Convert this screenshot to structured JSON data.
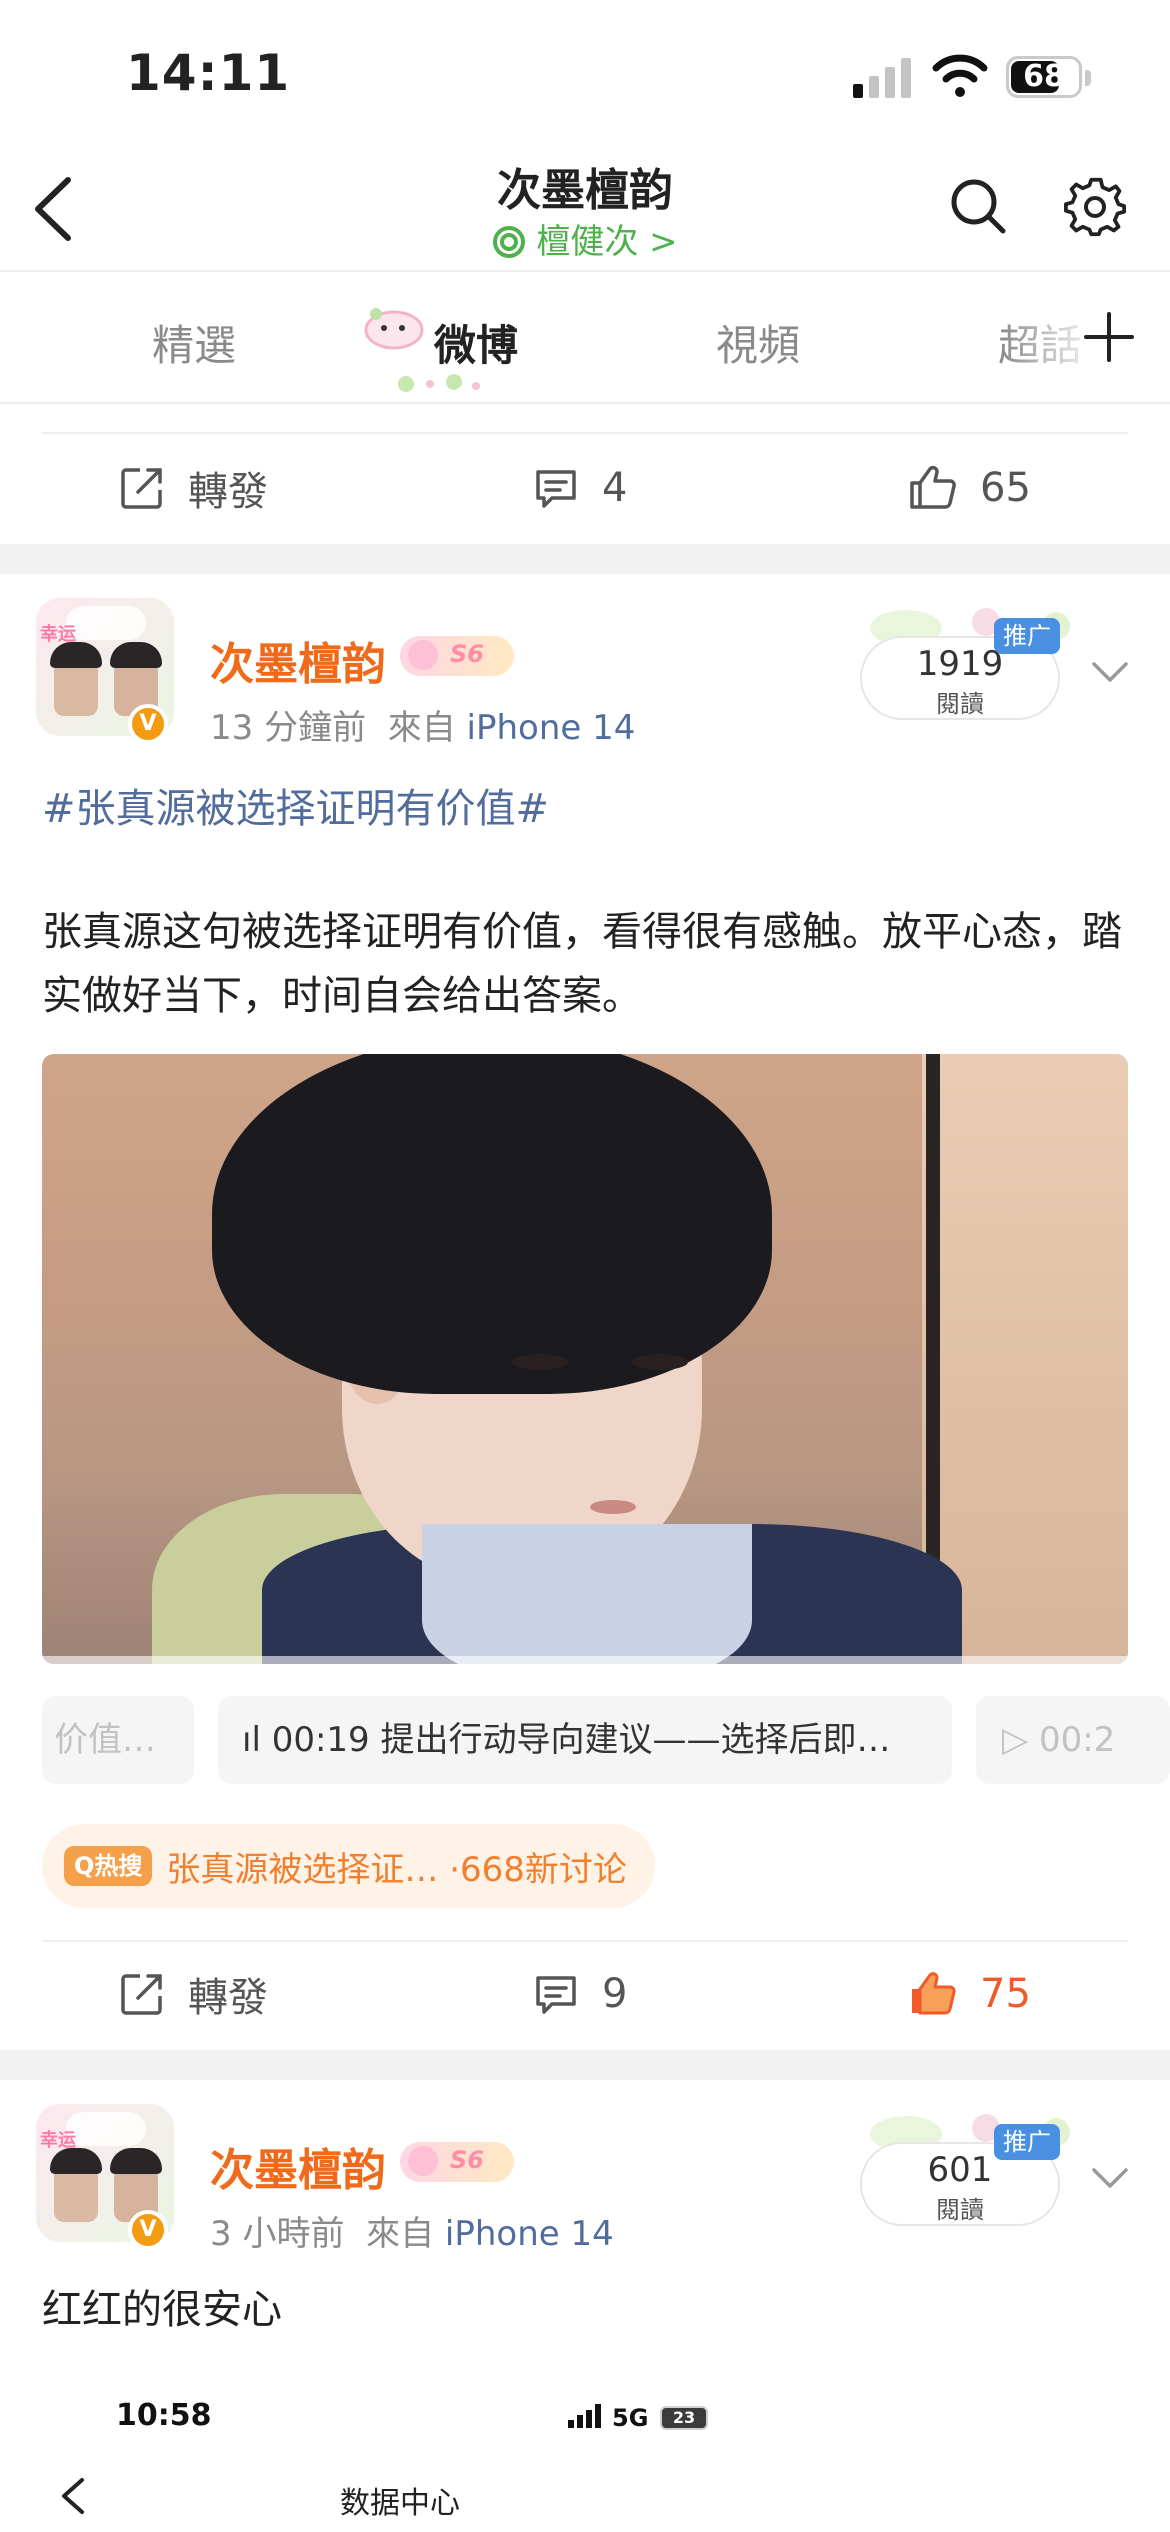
{
  "status": {
    "time": "14:11",
    "battery": "68"
  },
  "nav": {
    "title": "次墨檀韵",
    "subtitle": "檀健次 >"
  },
  "tabs": [
    {
      "label": "精選"
    },
    {
      "label": "微博"
    },
    {
      "label": "視頻"
    },
    {
      "label": "超話"
    }
  ],
  "prev_post": {
    "repost_label": "轉發",
    "comments": "4",
    "likes": "65"
  },
  "posts": [
    {
      "author": "次墨檀韵",
      "level": "S6",
      "time": "13 分鐘前",
      "from": "來自",
      "device": "iPhone 14",
      "reads": "1919",
      "reads_label": "閱讀",
      "promo": "推广",
      "hashtag": "#张真源被选择证明有价值#",
      "text": "张真源这句被选择证明有价值，看得很有感触。放平心态，踏实做好当下，时间自会给出答案。",
      "chapters": [
        {
          "label": "价值…"
        },
        {
          "label": "ıl 00:19 提出行动导向建议——选择后即…"
        },
        {
          "label": "▷ 00:2"
        }
      ],
      "hot": {
        "badge": "Q热搜",
        "text": "张真源被选择证… ·668新讨论"
      },
      "repost_label": "轉發",
      "comments": "9",
      "likes": "75"
    },
    {
      "author": "次墨檀韵",
      "level": "S6",
      "time": "3 小時前",
      "from": "來自",
      "device": "iPhone 14",
      "reads": "601",
      "reads_label": "閱讀",
      "promo": "推广",
      "text": "红红的很安心"
    }
  ],
  "embedded_screenshot": {
    "time": "10:58",
    "network": "5G",
    "battery": "23",
    "title": "数据中心"
  },
  "colors": {
    "accent_green": "#4fb14d",
    "author_orange": "#f06a1c",
    "link_blue": "#526d9c",
    "like_red": "#f05a2a"
  }
}
